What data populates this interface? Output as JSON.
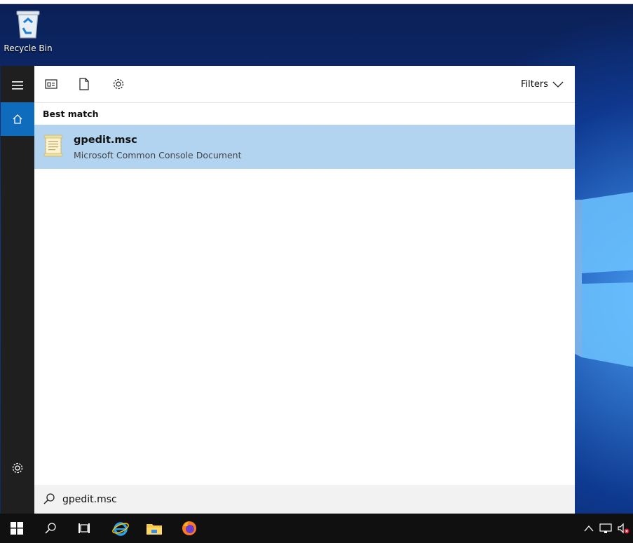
{
  "desktop": {
    "recycle_bin_label": "Recycle Bin"
  },
  "search_panel": {
    "filters_label": "Filters",
    "section_title": "Best match",
    "best_match": {
      "title": "gpedit.msc",
      "subtitle": "Microsoft Common Console Document",
      "icon": "console-document-icon"
    },
    "query": "gpedit.msc"
  },
  "left_rail": {
    "items": [
      {
        "name": "menu",
        "icon": "hamburger-icon"
      },
      {
        "name": "home",
        "icon": "home-icon",
        "active": true
      },
      {
        "name": "settings",
        "icon": "gear-icon"
      }
    ]
  },
  "toolbar_icons": [
    "apps-icon",
    "documents-icon",
    "settings-icon"
  ],
  "taskbar": {
    "items": [
      "start-button",
      "search-button",
      "task-view-button",
      "internet-explorer",
      "file-explorer",
      "firefox"
    ]
  },
  "colors": {
    "accent": "#0f6cbd",
    "selection": "#b3d4f0",
    "rail": "#1f1f1f",
    "taskbar": "#101010"
  }
}
